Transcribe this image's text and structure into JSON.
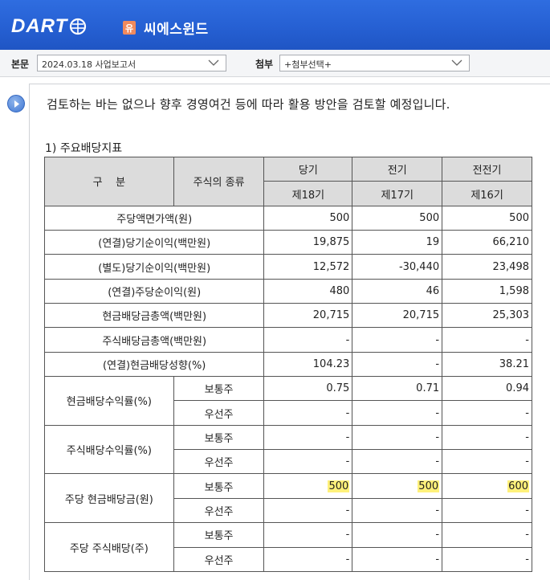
{
  "header": {
    "logo_text": "DART",
    "company_badge": "유",
    "company_name": "씨에스윈드"
  },
  "toolbar": {
    "main_label": "본문",
    "main_select_value": "2024.03.18  사업보고서",
    "attach_label": "첨부",
    "attach_select_value": "+첨부선택+"
  },
  "content": {
    "paragraph": "검토하는 바는 없으나 향후 경영여건 등에 따라 활용 방안을 검토할 예정입니다.",
    "section_title": "1) 주요배당지표"
  },
  "table": {
    "header": {
      "category": "구    분",
      "stock_type": "주식의 종류",
      "periods": [
        "당기",
        "전기",
        "전전기"
      ],
      "terms": [
        "제18기",
        "제17기",
        "제16기"
      ]
    },
    "simple_rows": [
      {
        "label": "주당액면가액(원)",
        "values": [
          "500",
          "500",
          "500"
        ]
      },
      {
        "label": "(연결)당기순이익(백만원)",
        "values": [
          "19,875",
          "19",
          "66,210"
        ]
      },
      {
        "label": "(별도)당기순이익(백만원)",
        "values": [
          "12,572",
          "-30,440",
          "23,498"
        ]
      },
      {
        "label": "(연결)주당순이익(원)",
        "values": [
          "480",
          "46",
          "1,598"
        ]
      },
      {
        "label": "현금배당금총액(백만원)",
        "values": [
          "20,715",
          "20,715",
          "25,303"
        ]
      },
      {
        "label": "주식배당금총액(백만원)",
        "values": [
          "-",
          "-",
          "-"
        ]
      },
      {
        "label": "(연결)현금배당성향(%)",
        "values": [
          "104.23",
          "-",
          "38.21"
        ]
      }
    ],
    "group_rows": [
      {
        "label": "현금배당수익률(%)",
        "sub": [
          {
            "type": "보통주",
            "values": [
              "0.75",
              "0.71",
              "0.94"
            ]
          },
          {
            "type": "우선주",
            "values": [
              "-",
              "-",
              "-"
            ]
          }
        ]
      },
      {
        "label": "주식배당수익률(%)",
        "sub": [
          {
            "type": "보통주",
            "values": [
              "-",
              "-",
              "-"
            ]
          },
          {
            "type": "우선주",
            "values": [
              "-",
              "-",
              "-"
            ]
          }
        ]
      },
      {
        "label": "주당 현금배당금(원)",
        "sub": [
          {
            "type": "보통주",
            "values": [
              "500",
              "500",
              "600"
            ]
          },
          {
            "type": "우선주",
            "values": [
              "-",
              "-",
              "-"
            ]
          }
        ]
      },
      {
        "label": "주당 주식배당(주)",
        "sub": [
          {
            "type": "보통주",
            "values": [
              "-",
              "-",
              "-"
            ]
          },
          {
            "type": "우선주",
            "values": [
              "-",
              "-",
              "-"
            ]
          }
        ]
      }
    ]
  },
  "colors": {
    "header_blue": "#2660d3",
    "highlight": "#fff17a",
    "badge": "#f08a5d"
  }
}
